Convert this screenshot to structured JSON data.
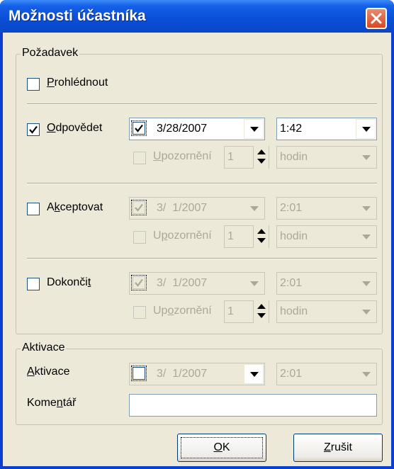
{
  "window": {
    "title": "Možnosti účastníka"
  },
  "pozadavek": {
    "legend": "Požadavek",
    "prohlednout": {
      "label_pre": "",
      "label_acc": "P",
      "label_post": "rohlédnout",
      "checked": false
    },
    "odpovedet": {
      "label_pre": "",
      "label_acc": "O",
      "label_post": "dpovědet",
      "checked": true,
      "date_checked": true,
      "date": "3/28/2007",
      "time": "1:42",
      "reminder_pre": "",
      "reminder_acc": "U",
      "reminder_post": "pozornění",
      "reminder_value": "1",
      "reminder_unit": "hodin"
    },
    "akceptovat": {
      "label_pre": "A",
      "label_acc": "k",
      "label_post": "ceptovat",
      "checked": false,
      "date_checked": true,
      "date": "3/  1/2007",
      "time": "2:01",
      "reminder_pre": "U",
      "reminder_acc": "p",
      "reminder_post": "ozornění",
      "reminder_value": "1",
      "reminder_unit": "hodin"
    },
    "dokoncit": {
      "label_pre": "Dokonči",
      "label_acc": "t",
      "label_post": "",
      "checked": false,
      "date_checked": true,
      "date": "3/  1/2007",
      "time": "2:01",
      "reminder_pre": "Up",
      "reminder_acc": "o",
      "reminder_post": "zornění",
      "reminder_value": "1",
      "reminder_unit": "hodin"
    }
  },
  "aktivace": {
    "legend": "Aktivace",
    "label_pre": "",
    "label_acc": "A",
    "label_post": "ktivace",
    "date_checked": false,
    "date": "3/  1/2007",
    "time": "2:01",
    "komentar_pre": "Kome",
    "komentar_acc": "n",
    "komentar_post": "tář",
    "komentar_value": ""
  },
  "buttons": {
    "ok_pre": "",
    "ok_acc": "O",
    "ok_post": "K",
    "cancel_pre": "",
    "cancel_acc": "Z",
    "cancel_post": "rušit"
  }
}
